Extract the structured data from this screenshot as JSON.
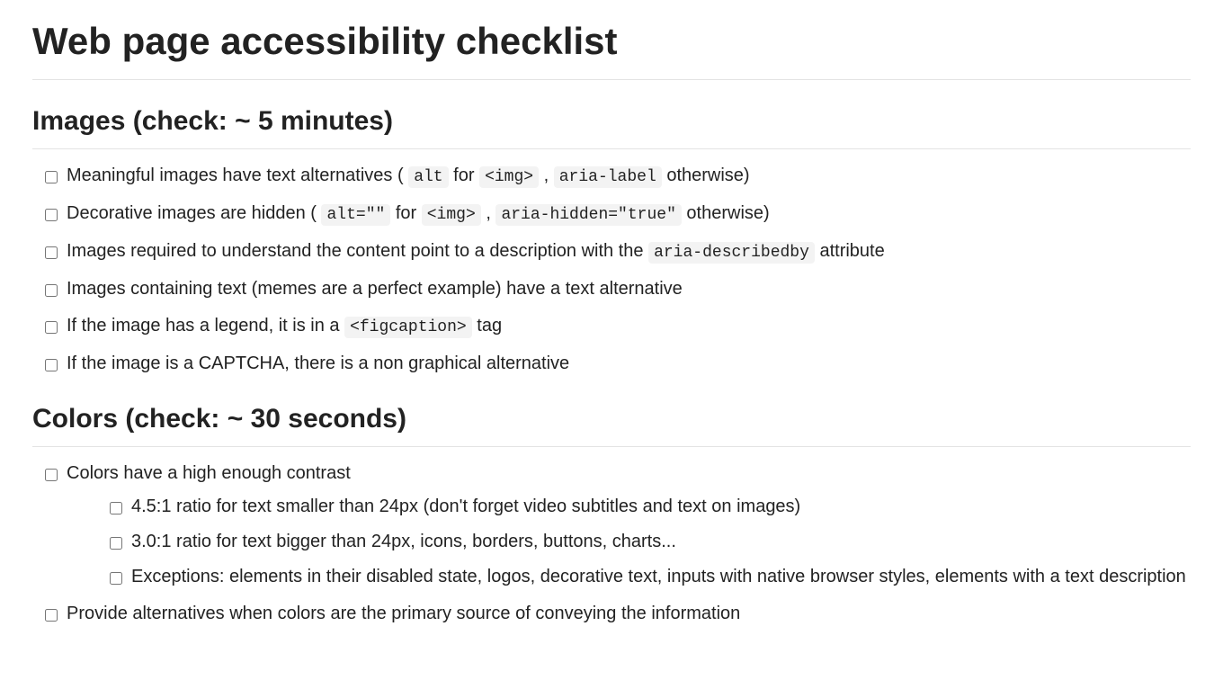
{
  "title": "Web page accessibility checklist",
  "sections": {
    "images": {
      "heading": "Images (check: ~ 5 minutes)",
      "items": [
        {
          "segments": [
            {
              "t": "text",
              "v": "Meaningful images have text alternatives ( "
            },
            {
              "t": "code",
              "v": "alt"
            },
            {
              "t": "text",
              "v": " for "
            },
            {
              "t": "code",
              "v": "<img>"
            },
            {
              "t": "text",
              "v": " , "
            },
            {
              "t": "code",
              "v": "aria-label"
            },
            {
              "t": "text",
              "v": " otherwise)"
            }
          ]
        },
        {
          "segments": [
            {
              "t": "text",
              "v": "Decorative images are hidden ( "
            },
            {
              "t": "code",
              "v": "alt=\"\""
            },
            {
              "t": "text",
              "v": " for "
            },
            {
              "t": "code",
              "v": "<img>"
            },
            {
              "t": "text",
              "v": " , "
            },
            {
              "t": "code",
              "v": "aria-hidden=\"true\""
            },
            {
              "t": "text",
              "v": " otherwise)"
            }
          ]
        },
        {
          "segments": [
            {
              "t": "text",
              "v": "Images required to understand the content point to a description with the "
            },
            {
              "t": "code",
              "v": "aria-describedby"
            },
            {
              "t": "text",
              "v": " attribute"
            }
          ]
        },
        {
          "segments": [
            {
              "t": "text",
              "v": "Images containing text (memes are a perfect example) have a text alternative"
            }
          ]
        },
        {
          "segments": [
            {
              "t": "text",
              "v": "If the image has a legend, it is in a "
            },
            {
              "t": "code",
              "v": "<figcaption>"
            },
            {
              "t": "text",
              "v": " tag"
            }
          ]
        },
        {
          "segments": [
            {
              "t": "text",
              "v": "If the image is a CAPTCHA, there is a non graphical alternative"
            }
          ]
        }
      ]
    },
    "colors": {
      "heading": "Colors (check: ~ 30 seconds)",
      "items": [
        {
          "segments": [
            {
              "t": "text",
              "v": "Colors have a high enough contrast"
            }
          ],
          "children": [
            {
              "segments": [
                {
                  "t": "text",
                  "v": "4.5:1 ratio for text smaller than 24px (don't forget video subtitles and text on images)"
                }
              ]
            },
            {
              "segments": [
                {
                  "t": "text",
                  "v": "3.0:1 ratio for text bigger than 24px, icons, borders, buttons, charts..."
                }
              ]
            },
            {
              "segments": [
                {
                  "t": "text",
                  "v": "Exceptions: elements in their disabled state, logos, decorative text, inputs with native browser styles, elements with a text description"
                }
              ]
            }
          ]
        },
        {
          "segments": [
            {
              "t": "text",
              "v": "Provide alternatives when colors are the primary source of conveying the information"
            }
          ]
        }
      ]
    }
  }
}
